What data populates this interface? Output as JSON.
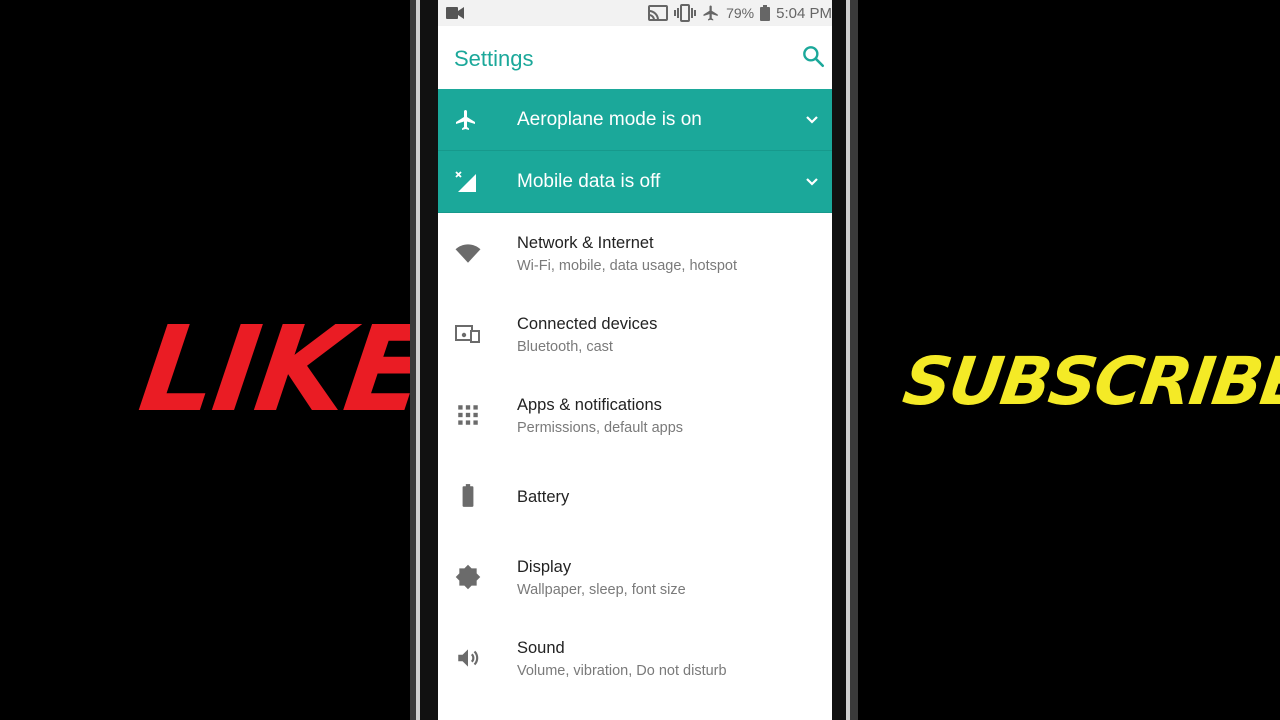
{
  "overlay": {
    "like": "LIKE",
    "subscribe": "SUBSCRIBE",
    "like_color": "#ea1c24",
    "subscribe_color": "#f4ea26"
  },
  "status_bar": {
    "battery_percent": "79%",
    "time": "5:04 PM",
    "icons": [
      "video-camera-icon",
      "cast-icon",
      "vibrate-icon",
      "airplane-icon",
      "battery-icon"
    ]
  },
  "app_bar": {
    "title": "Settings",
    "search_icon": "search-icon",
    "accent": "#1ba89a"
  },
  "banners": [
    {
      "label": "Aeroplane mode is on",
      "icon": "airplane-icon"
    },
    {
      "label": "Mobile data is off",
      "icon": "signal-off-icon"
    }
  ],
  "items": [
    {
      "title": "Network & Internet",
      "subtitle": "Wi-Fi, mobile, data usage, hotspot",
      "icon": "wifi-icon"
    },
    {
      "title": "Connected devices",
      "subtitle": "Bluetooth, cast",
      "icon": "devices-icon"
    },
    {
      "title": "Apps & notifications",
      "subtitle": "Permissions, default apps",
      "icon": "apps-grid-icon"
    },
    {
      "title": "Battery",
      "subtitle": "",
      "icon": "battery-icon"
    },
    {
      "title": "Display",
      "subtitle": "Wallpaper, sleep, font size",
      "icon": "brightness-icon"
    },
    {
      "title": "Sound",
      "subtitle": "Volume, vibration, Do not disturb",
      "icon": "speaker-icon"
    }
  ]
}
